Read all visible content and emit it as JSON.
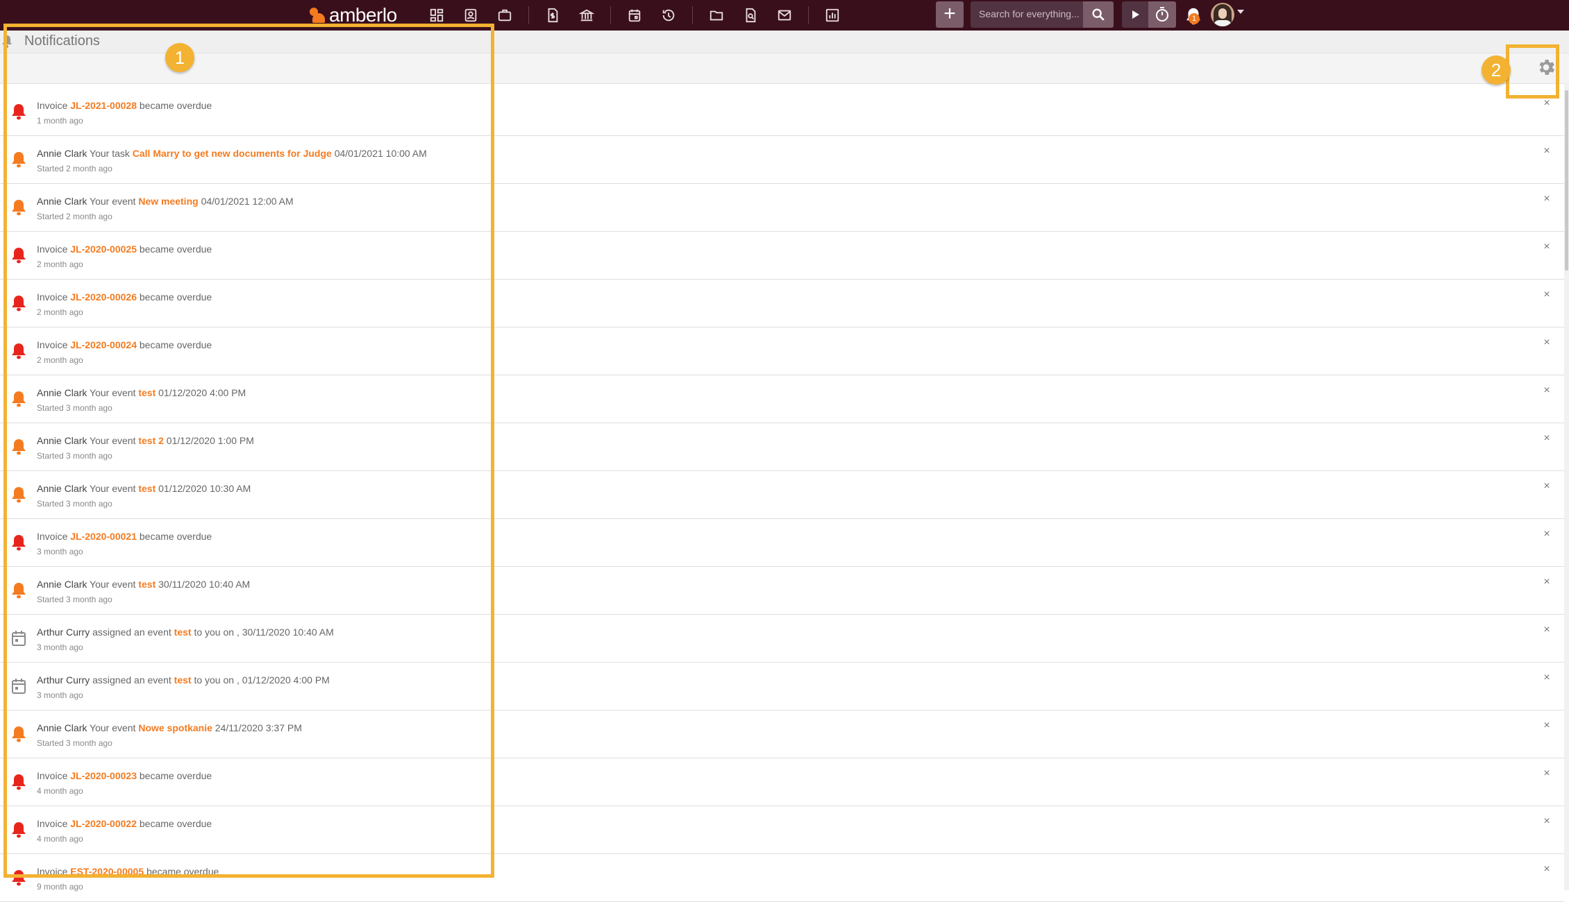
{
  "brand": {
    "name": "amberlo"
  },
  "nav": {
    "icons": [
      "dashboard-icon",
      "contacts-icon",
      "matters-icon",
      "invoices-icon",
      "bank-icon",
      "calendar-icon",
      "time-history-icon",
      "documents-icon",
      "document-templates-icon",
      "mail-icon",
      "reports-icon"
    ]
  },
  "search": {
    "placeholder": "Search for everything..."
  },
  "topbar": {
    "add_label": "+",
    "notification_count": "1"
  },
  "page": {
    "title": "Notifications"
  },
  "callouts": {
    "one": "1",
    "two": "2"
  },
  "notifications": [
    {
      "type": "invoice",
      "who": "",
      "pre": "Invoice ",
      "link": "JL-2021-00028",
      "post": " became overdue",
      "meta": "1 month ago"
    },
    {
      "type": "task",
      "who": "Annie Clark",
      "pre": " Your task ",
      "link": "Call Marry to get new documents for Judge",
      "post": " 04/01/2021 10:00 AM",
      "meta": "Started 2 month ago"
    },
    {
      "type": "event",
      "who": "Annie Clark",
      "pre": " Your event ",
      "link": "New meeting",
      "post": " 04/01/2021 12:00 AM",
      "meta": "Started 2 month ago"
    },
    {
      "type": "invoice",
      "who": "",
      "pre": "Invoice ",
      "link": "JL-2020-00025",
      "post": " became overdue",
      "meta": "2 month ago"
    },
    {
      "type": "invoice",
      "who": "",
      "pre": "Invoice ",
      "link": "JL-2020-00026",
      "post": " became overdue",
      "meta": "2 month ago"
    },
    {
      "type": "invoice",
      "who": "",
      "pre": "Invoice ",
      "link": "JL-2020-00024",
      "post": " became overdue",
      "meta": "2 month ago"
    },
    {
      "type": "event",
      "who": "Annie Clark",
      "pre": " Your event ",
      "link": "test",
      "post": " 01/12/2020 4:00 PM",
      "meta": "Started 3 month ago"
    },
    {
      "type": "event",
      "who": "Annie Clark",
      "pre": " Your event ",
      "link": "test 2",
      "post": " 01/12/2020 1:00 PM",
      "meta": "Started 3 month ago"
    },
    {
      "type": "event",
      "who": "Annie Clark",
      "pre": " Your event ",
      "link": "test",
      "post": " 01/12/2020 10:30 AM",
      "meta": "Started 3 month ago"
    },
    {
      "type": "invoice",
      "who": "",
      "pre": "Invoice ",
      "link": "JL-2020-00021",
      "post": " became overdue",
      "meta": "3 month ago"
    },
    {
      "type": "event",
      "who": "Annie Clark",
      "pre": " Your event ",
      "link": "test",
      "post": " 30/11/2020 10:40 AM",
      "meta": "Started 3 month ago"
    },
    {
      "type": "assigned",
      "who": "Arthur Curry",
      "pre": " assigned an event ",
      "link": "test",
      "post": " to you on , 30/11/2020 10:40 AM",
      "meta": "3 month ago"
    },
    {
      "type": "assigned",
      "who": "Arthur Curry",
      "pre": " assigned an event ",
      "link": "test",
      "post": " to you on , 01/12/2020 4:00 PM",
      "meta": "3 month ago"
    },
    {
      "type": "event",
      "who": "Annie Clark",
      "pre": " Your event ",
      "link": "Nowe spotkanie",
      "post": " 24/11/2020 3:37 PM",
      "meta": "Started 3 month ago"
    },
    {
      "type": "invoice",
      "who": "",
      "pre": "Invoice ",
      "link": "JL-2020-00023",
      "post": " became overdue",
      "meta": "4 month ago"
    },
    {
      "type": "invoice",
      "who": "",
      "pre": "Invoice ",
      "link": "JL-2020-00022",
      "post": " became overdue",
      "meta": "4 month ago"
    },
    {
      "type": "invoice",
      "who": "",
      "pre": "Invoice ",
      "link": "EST-2020-00005",
      "post": " became overdue",
      "meta": "9 month ago"
    }
  ],
  "colors": {
    "topbar": "#3a0f1c",
    "accent": "#f47b20",
    "overdue_bell": "#e8251d",
    "reminder_bell": "#f47b20",
    "calendar_icon": "#8a8a8a",
    "highlight": "#f3b232"
  }
}
